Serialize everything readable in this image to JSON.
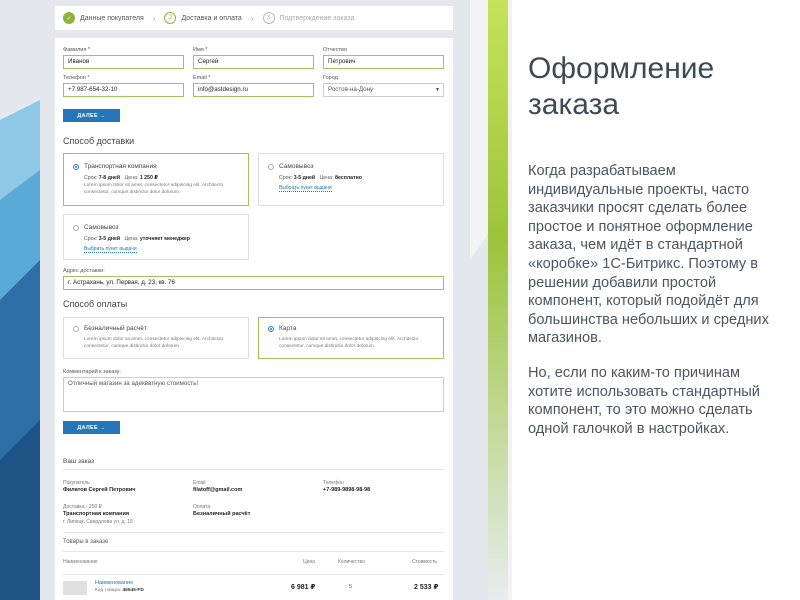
{
  "steps": [
    {
      "label": "Данные покупателя",
      "state": "done"
    },
    {
      "label": "Доставка и оплата",
      "num": "2",
      "state": "active"
    },
    {
      "label": "Подтверждение заказа",
      "num": "3",
      "state": "next"
    }
  ],
  "buyer": {
    "last_name_label": "Фамилия *",
    "last_name": "Иванов",
    "first_name_label": "Имя *",
    "first_name": "Сергей",
    "middle_name_label": "Отчество",
    "middle_name": "Петрович",
    "phone_label": "Телефон *",
    "phone": "+7 987-654-32-10",
    "email_label": "Email *",
    "email": "info@astdesign.ru",
    "city_label": "Город",
    "city": "Ростов-на-Дону"
  },
  "next_button": "ДАЛЕЕ →",
  "next_button_2": "ДАЛЕЕ →",
  "delivery": {
    "title": "Способ доставки",
    "options": [
      {
        "title": "Транспортная компания",
        "term_label": "Срок:",
        "term": "7-8 дней",
        "price_label": "Цена:",
        "price": "1 250 ₽",
        "desc": "Lorem ipsum dolor sit amet, consectetur adipiscing elit. Architecto consectetur, cumque distinctio dolor dolorum.",
        "selected": true
      },
      {
        "title": "Самовывоз",
        "term_label": "Срок:",
        "term": "3-5 дней",
        "price_label": "Цена:",
        "price": "бесплатно",
        "link": "Выбрать пункт выдачи",
        "selected": false
      },
      {
        "title": "Самовывоз",
        "term_label": "Срок:",
        "term": "3-5 дней",
        "price_label": "Цена:",
        "price": "уточняет менеджер",
        "link": "Выбрать пункт выдачи",
        "selected": false
      }
    ],
    "address_label": "Адрес доставки:",
    "address": "г. Астрахань, ул. Первая, д. 23, кв. 76"
  },
  "payment": {
    "title": "Способ оплаты",
    "options": [
      {
        "title": "Безналичный расчёт",
        "desc": "Lorem ipsum dolor sit amet, consectetur adipiscing elit. Architecto consectetur, cumque distinctio dolor dolorum.",
        "selected": false
      },
      {
        "title": "Карта",
        "desc": "Lorem ipsum dolor sit amet, consectetur adipiscing elit. Architecto consectetur, cumque distinctio dolor dolorum.",
        "selected": true
      }
    ]
  },
  "comment": {
    "label": "Комментарий к заказу:",
    "value": "Отличный магазин за адекватную стоимость!"
  },
  "order": {
    "title": "Ваш заказ",
    "buyer_label": "Покупатель",
    "buyer": "Филатов Сергей Петрович",
    "email_label": "Email",
    "email": "filatoff@gmail.com",
    "phone_label": "Телефон",
    "phone": "+7-989-9898-98-98",
    "delivery_label": "Доставка - 250 ₽",
    "delivery": "Транспортная компания",
    "delivery_address": "г. Липецк, Свердлова ул, д. 15",
    "payment_label": "Оплата",
    "payment": "Безналичный расчёт"
  },
  "products": {
    "title": "Товары в заказе",
    "headers": {
      "name": "Наименование",
      "price": "Цена",
      "qty": "Количество",
      "total": "Стоимость"
    },
    "rows": [
      {
        "name": "Наименование",
        "code_label": "Код товара:",
        "code": "46545-FD",
        "price": "6 981 ₽",
        "qty": "5",
        "total": "2 533 ₽"
      }
    ]
  },
  "aside": {
    "title": "Оформление заказа",
    "p1": "Когда разрабатываем индивидуальные проекты, часто заказчики просят сделать более простое и понятное оформление заказа, чем идёт в стандартной «коробке» 1С-Битрикс. Поэтому в решении добавили простой компонент, который подойдёт для большинства небольших и средних магазинов.",
    "p2": "Но, если по каким-то причинам хотите использовать стандартный компонент, то это можно сделать одной галочкой в настройках."
  },
  "colors": {
    "accent": "#2677b9",
    "green": "#8cb53b",
    "border_selected": "#9cc65a"
  }
}
